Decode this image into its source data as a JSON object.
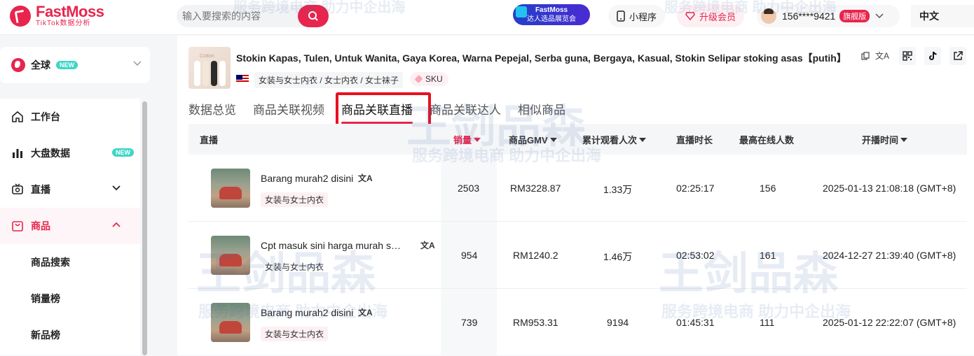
{
  "header": {
    "logo_title": "FastMoss",
    "logo_subtitle": "TikTok数据分析",
    "search_placeholder": "输入要搜索的内容",
    "promo_line1": "FastMoss",
    "promo_line2": "达人选品展览会",
    "mini_program": "小程序",
    "upgrade": "升级会员",
    "user_phone": "156****9421",
    "user_badge": "旗舰版",
    "language": "中文"
  },
  "sidebar": {
    "region": "全球",
    "region_badge": "NEW",
    "items": [
      {
        "label": "工作台",
        "icon": "home-icon"
      },
      {
        "label": "大盘数据",
        "icon": "bar-chart-icon",
        "badge": "NEW"
      },
      {
        "label": "直播",
        "icon": "live-tv-icon"
      },
      {
        "label": "商品",
        "icon": "shopping-bag-icon"
      }
    ],
    "sub_items": [
      "商品搜索",
      "销量榜",
      "新品榜"
    ]
  },
  "product": {
    "title": "Stokin Kapas, Tulen, Untuk Wanita, Gaya Korea, Warna Pepejal, Serba guna, Bergaya, Kasual, Stokin Selipar stoking asas【putih】",
    "image_label": "Cotton",
    "category": "女装与女士内衣 / 女士内衣 / 女士袜子",
    "sku_label": "SKU",
    "translate_glyph": "文A"
  },
  "tabs": [
    "数据总览",
    "商品关联视频",
    "商品关联直播",
    "商品关联达人",
    "相似商品"
  ],
  "active_tab": "商品关联直播",
  "table": {
    "headers": {
      "live": "直播",
      "sales": "销量",
      "gmv": "商品GMV",
      "viewers": "累计观看人次",
      "duration": "直播时长",
      "peak": "最高在线人数",
      "start": "开播时间"
    },
    "rows": [
      {
        "title": "Barang murah2 disini",
        "tag": "女装与女士内衣",
        "sales": "2503",
        "gmv": "RM3228.87",
        "viewers": "1.33万",
        "duration": "02:25:17",
        "peak": "156",
        "start": "2025-01-13 21:08:18 (GMT+8)"
      },
      {
        "title": "Cpt masuk sini harga murah sangat",
        "tag": "女装与女士内衣",
        "sales": "954",
        "gmv": "RM1240.2",
        "viewers": "1.46万",
        "duration": "02:53:02",
        "peak": "161",
        "start": "2024-12-27 21:39:40 (GMT+8)"
      },
      {
        "title": "Barang murah2 disini",
        "tag": "女装与女士内衣",
        "sales": "739",
        "gmv": "RM953.31",
        "viewers": "9194",
        "duration": "01:45:31",
        "peak": "111",
        "start": "2025-01-12 22:22:07 (GMT+8)"
      }
    ]
  },
  "watermark": {
    "brand": "王剑品森",
    "slogan": "服务跨境电商 助力中企出海"
  },
  "colors": {
    "accent": "#e8254d",
    "highlight_box": "#e8101f",
    "new_badge": "#3ed6c6"
  }
}
